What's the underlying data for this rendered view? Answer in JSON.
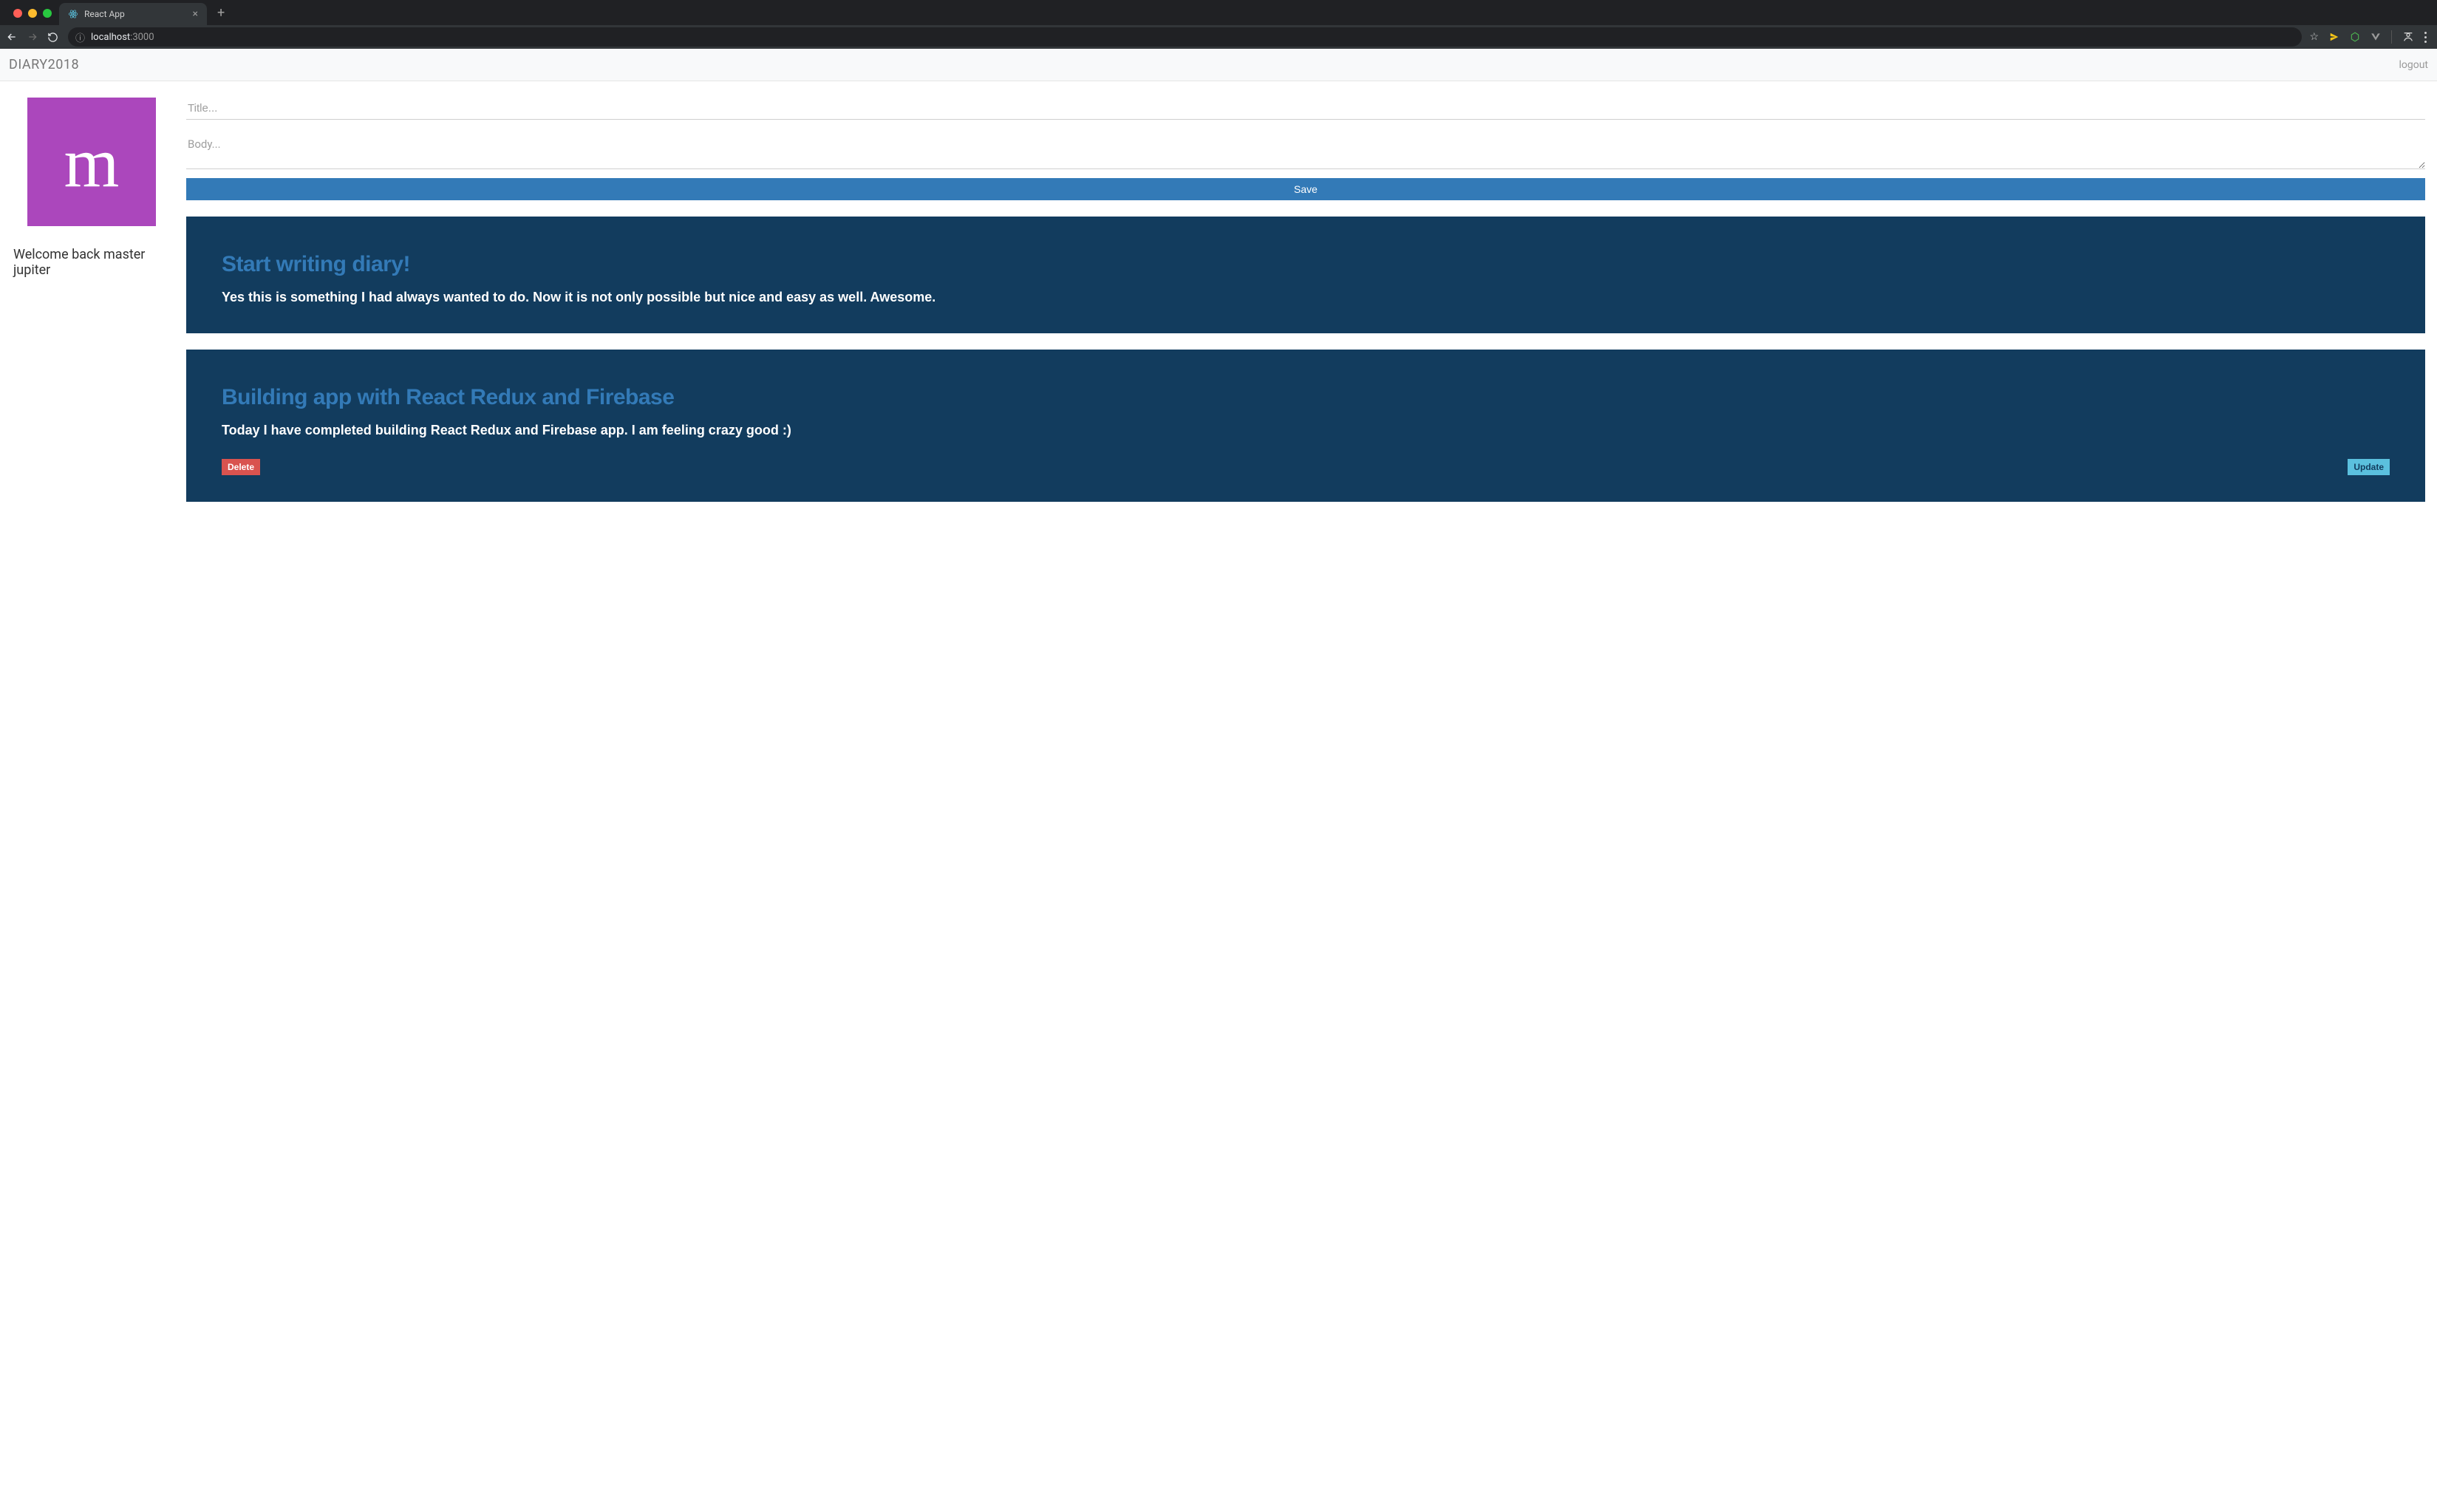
{
  "browser": {
    "tab_title": "React App",
    "url_host": "localhost",
    "url_port": ":3000"
  },
  "navbar": {
    "brand": "DIARY2018",
    "logout": "logout"
  },
  "sidebar": {
    "avatar_letter": "m",
    "welcome": "Welcome back master jupiter"
  },
  "form": {
    "title_placeholder": "Title...",
    "body_placeholder": "Body...",
    "save_label": "Save"
  },
  "entries": [
    {
      "title": "Start writing diary!",
      "body": "Yes this is something I had always wanted to do. Now it is not only possible but nice and easy as well. Awesome."
    },
    {
      "title": "Building app with React Redux and Firebase",
      "body": "Today I have completed building React Redux and Firebase app. I am feeling crazy good :)",
      "delete_label": "Delete",
      "update_label": "Update"
    }
  ]
}
